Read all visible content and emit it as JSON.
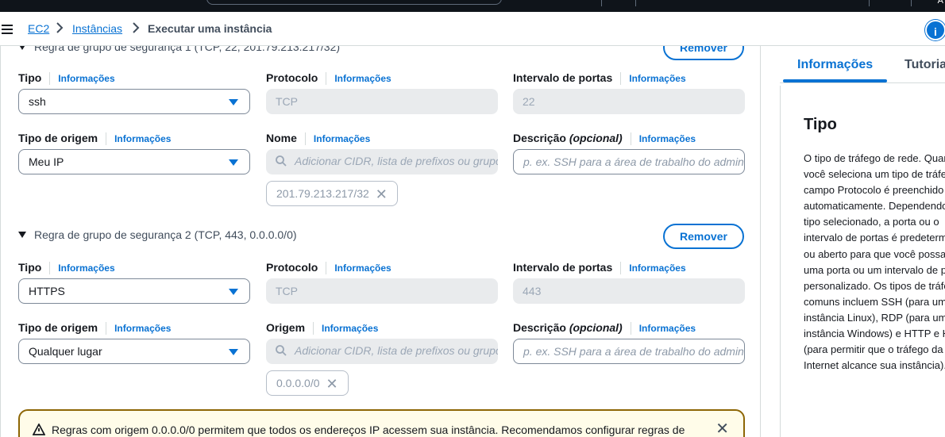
{
  "topbar": {
    "right_text": "A"
  },
  "breadcrumb": {
    "items": [
      {
        "label": "EC2"
      },
      {
        "label": "Instâncias"
      }
    ],
    "current": "Executar uma instância",
    "separator": ">"
  },
  "info_button": {
    "label": "i"
  },
  "rule1": {
    "header_partial": "Regra de grupo de segurança 1 (TCP, 22, 201.79.213.217/32)",
    "remove_label": "Remover",
    "type_label": "Tipo",
    "type_info": "Informações",
    "type_value": "ssh",
    "protocol_label": "Protocolo",
    "protocol_info": "Informações",
    "protocol_value": "TCP",
    "ports_label": "Intervalo de portas",
    "ports_info": "Informações",
    "ports_value": "22",
    "source_type_label": "Tipo de origem",
    "source_type_info": "Informações",
    "source_type_value": "Meu IP",
    "name_label": "Nome",
    "name_info": "Informações",
    "name_placeholder": "Adicionar CIDR, lista de prefixos ou grupo de segurança",
    "token": "201.79.213.217/32",
    "desc_label": "Descrição",
    "desc_optional": "(opcional)",
    "desc_info": "Informações",
    "desc_placeholder": "p. ex. SSH para a área de trabalho do administrador"
  },
  "rule2": {
    "header": "Regra de grupo de segurança 2 (TCP, 443, 0.0.0.0/0)",
    "remove_label": "Remover",
    "type_label": "Tipo",
    "type_info": "Informações",
    "type_value": "HTTPS",
    "protocol_label": "Protocolo",
    "protocol_info": "Informações",
    "protocol_value": "TCP",
    "ports_label": "Intervalo de portas",
    "ports_info": "Informações",
    "ports_value": "443",
    "source_type_label": "Tipo de origem",
    "source_type_info": "Informações",
    "source_type_value": "Qualquer lugar",
    "origin_label": "Origem",
    "origin_info": "Informações",
    "origin_placeholder": "Adicionar CIDR, lista de prefixos ou grupo de segurança",
    "token": "0.0.0.0/0",
    "desc_label": "Descrição",
    "desc_optional": "(opcional)",
    "desc_info": "Informações",
    "desc_placeholder": "p. ex. SSH para a área de trabalho do administrador"
  },
  "warning": {
    "text": "Regras com origem 0.0.0.0/0 permitem que todos os endereços IP acessem sua instância. Recomendamos configurar regras de"
  },
  "help_panel": {
    "tabs": [
      {
        "label": "Informações"
      },
      {
        "label": "Tutoriais"
      }
    ],
    "title": "Tipo",
    "body_lines": [
      "O tipo de tráfego de rede. Quando",
      "você seleciona um tipo de tráfego, o",
      "campo Protocolo é preenchido",
      "automaticamente. Dependendo do",
      "tipo selecionado, a porta ou o",
      "intervalo de portas é predeterminado",
      "ou aberto para que você possa inserir",
      "uma porta ou um intervalo de portas",
      "personalizado. Os tipos de tráfego",
      "comuns incluem SSH (para uma",
      "instância Linux), RDP (para uma",
      "instância Windows) e HTTP e HTTPS",
      "(para permitir que o tráfego da",
      "Internet alcance sua instância)."
    ]
  },
  "colors": {
    "link": "#0972d3",
    "warning_border": "#8d6605",
    "warning_bg": "#fffce9",
    "topbar": "#0f141a"
  }
}
